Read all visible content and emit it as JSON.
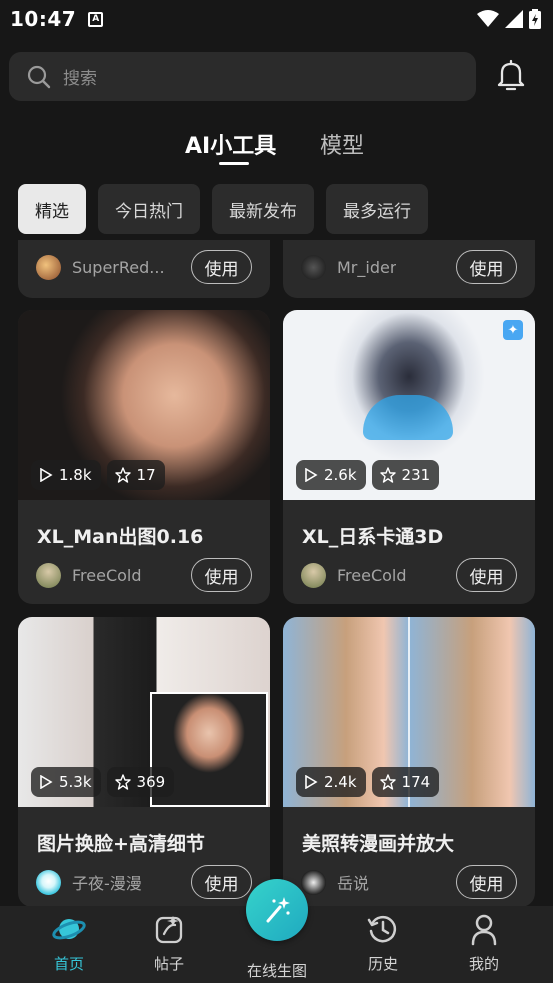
{
  "status_bar": {
    "time": "10:47",
    "app_icon_letter": "A"
  },
  "search": {
    "placeholder": "搜索"
  },
  "tabs": [
    {
      "label": "AI小工具",
      "active": true
    },
    {
      "label": "模型",
      "active": false
    }
  ],
  "filters": [
    {
      "label": "精选",
      "active": true
    },
    {
      "label": "今日热门",
      "active": false
    },
    {
      "label": "最新发布",
      "active": false
    },
    {
      "label": "最多运行",
      "active": false
    }
  ],
  "partial_cards": [
    {
      "author": "SuperRed...",
      "use_label": "使用"
    },
    {
      "author": "Mr_ider",
      "use_label": "使用"
    }
  ],
  "cards": [
    {
      "title": "XL_Man出图0.16",
      "author": "FreeCold",
      "runs": "1.8k",
      "stars": "17",
      "use_label": "使用"
    },
    {
      "title": "XL_日系卡通3D",
      "author": "FreeCold",
      "runs": "2.6k",
      "stars": "231",
      "use_label": "使用"
    },
    {
      "title": "图片换脸+高清细节",
      "author": "子夜-漫漫",
      "runs": "5.3k",
      "stars": "369",
      "use_label": "使用"
    },
    {
      "title": "美照转漫画并放大",
      "author": "岳说",
      "runs": "2.4k",
      "stars": "174",
      "use_label": "使用"
    }
  ],
  "bottom_nav": [
    {
      "label": "首页",
      "icon": "planet-icon",
      "active": true
    },
    {
      "label": "帖子",
      "icon": "post-icon",
      "active": false
    },
    {
      "label": "在线生图",
      "icon": "magic-wand-icon",
      "active": false
    },
    {
      "label": "历史",
      "icon": "history-icon",
      "active": false
    },
    {
      "label": "我的",
      "icon": "profile-icon",
      "active": false
    }
  ],
  "colors": {
    "accent": "#36c6d8",
    "background": "#171717",
    "card": "#2a2a2a"
  }
}
